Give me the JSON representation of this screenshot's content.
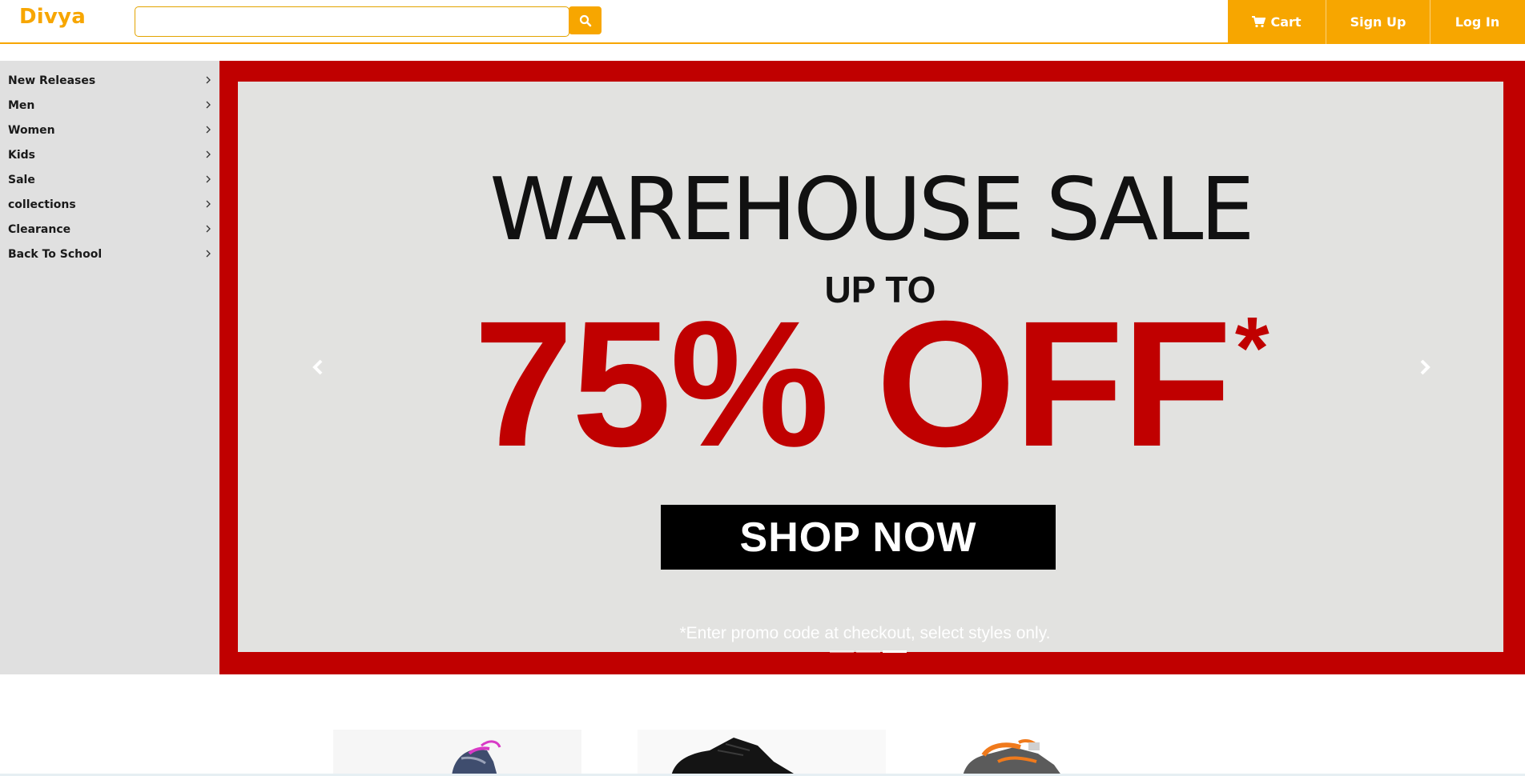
{
  "header": {
    "brand": "Divya",
    "search": {
      "value": "",
      "placeholder": ""
    },
    "search_icon": "search-icon",
    "nav": [
      {
        "label": "Cart",
        "icon": "cart-icon"
      },
      {
        "label": "Sign Up"
      },
      {
        "label": "Log In"
      }
    ]
  },
  "sidebar": {
    "items": [
      {
        "label": "New Releases"
      },
      {
        "label": "Men"
      },
      {
        "label": "Women"
      },
      {
        "label": "Kids"
      },
      {
        "label": "Sale"
      },
      {
        "label": "collections"
      },
      {
        "label": "Clearance"
      },
      {
        "label": "Back To School"
      }
    ]
  },
  "carousel": {
    "headline": "WAREHOUSE SALE",
    "up_to": "UP TO",
    "discount": "75% OFF",
    "asterisk": "*",
    "cta": "SHOP NOW",
    "footnote": "*Enter promo code at checkout, select styles only.",
    "indicator_count": 3,
    "active_indicator": 2
  },
  "colors": {
    "accent": "#f7a600",
    "banner_red": "#c00000",
    "banner_bg": "#e2e2e0",
    "sidebar_bg": "#e0e0e0"
  },
  "products": [
    {
      "name": "pink-lace-sneaker"
    },
    {
      "name": "black-sneaker"
    },
    {
      "name": "orange-lace-sneaker"
    }
  ]
}
